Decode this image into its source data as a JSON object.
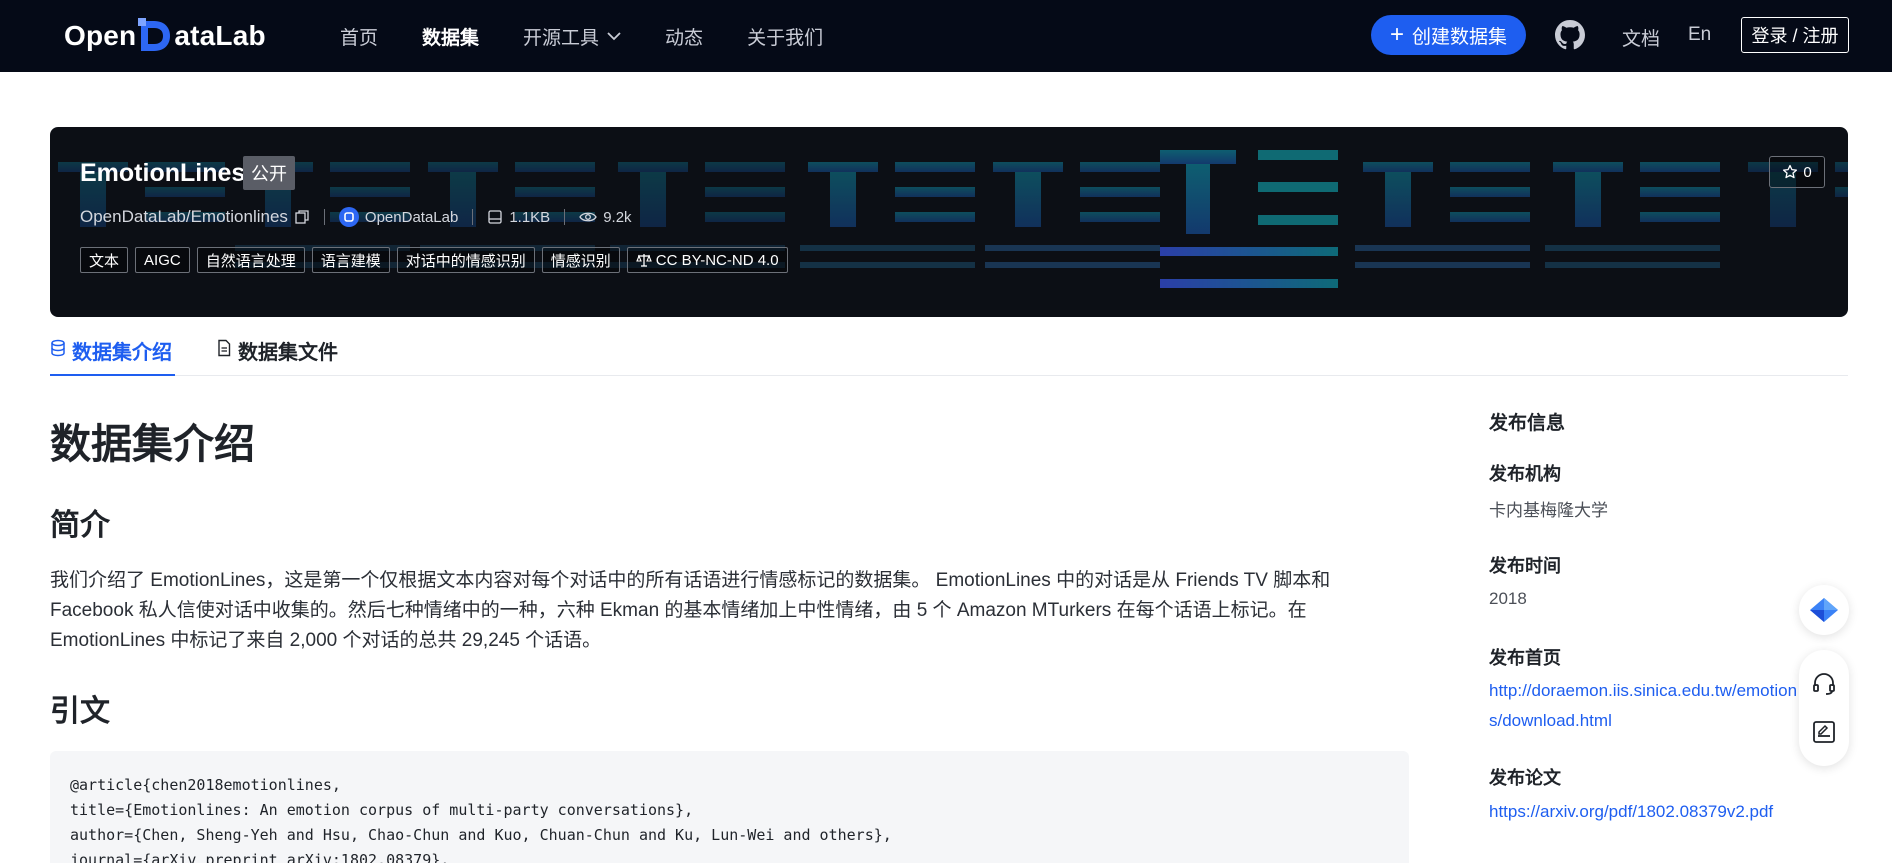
{
  "nav": {
    "logo_pre": "Open",
    "logo_post": "ataLab",
    "items": [
      "首页",
      "数据集",
      "开源工具",
      "动态",
      "关于我们"
    ],
    "active_index": 1,
    "create_label": "创建数据集",
    "docs_label": "文档",
    "lang_label": "En",
    "login_label": "登录 / 注册"
  },
  "hero": {
    "title": "EmotionLines",
    "badge": "公开",
    "repo": "OpenDataLab/Emotionlines",
    "org": "OpenDataLab",
    "size": "1.1KB",
    "views": "9.2k",
    "tags": [
      "文本",
      "AIGC",
      "自然语言处理",
      "语言建模",
      "对话中的情感识别",
      "情感识别"
    ],
    "license": "CC BY-NC-ND 4.0",
    "stars": "0"
  },
  "tabs": [
    "数据集介绍",
    "数据集文件"
  ],
  "content": {
    "h1": "数据集介绍",
    "intro_heading": "简介",
    "intro_lines": [
      "我们介绍了 EmotionLines，这是第一个仅根据文本内容对每个对话中的所有话语进行情感标记的数据集。 EmotionLines 中的对话是从 Friends TV 脚本和",
      "Facebook 私人信使对话中收集的。然后七种情绪中的一种，六种 Ekman 的基本情绪加上中性情绪，由 5 个 Amazon MTurkers 在每个话语上标记。在",
      "EmotionLines 中标记了来自 2,000 个对话的总共 29,245 个话语。"
    ],
    "cite_heading": "引文",
    "code_lines": [
      "@article{chen2018emotionlines,",
      "title={Emotionlines: An emotion corpus of multi-party conversations},",
      "author={Chen, Sheng-Yeh and Hsu, Chao-Chun and Kuo, Chuan-Chun and Ku, Lun-Wei and others},",
      "journal={arXiv preprint arXiv:1802.08379},"
    ]
  },
  "sidebar": {
    "title": "发布信息",
    "org_label": "发布机构",
    "org_value": "卡内基梅隆大学",
    "time_label": "发布时间",
    "time_value": "2018",
    "home_label": "发布首页",
    "home_value_1": "http://doraemon.iis.sinica.edu.tw/emotion",
    "home_value_2": "s/download.html",
    "paper_label": "发布论文",
    "paper_value": "https://arxiv.org/pdf/1802.08379v2.pdf"
  },
  "colors": {
    "nav_bg": "#050a17",
    "accent": "#1e5ef0",
    "hero_bg": "#0c0f15",
    "hero_pattern": "#0f6a73"
  }
}
